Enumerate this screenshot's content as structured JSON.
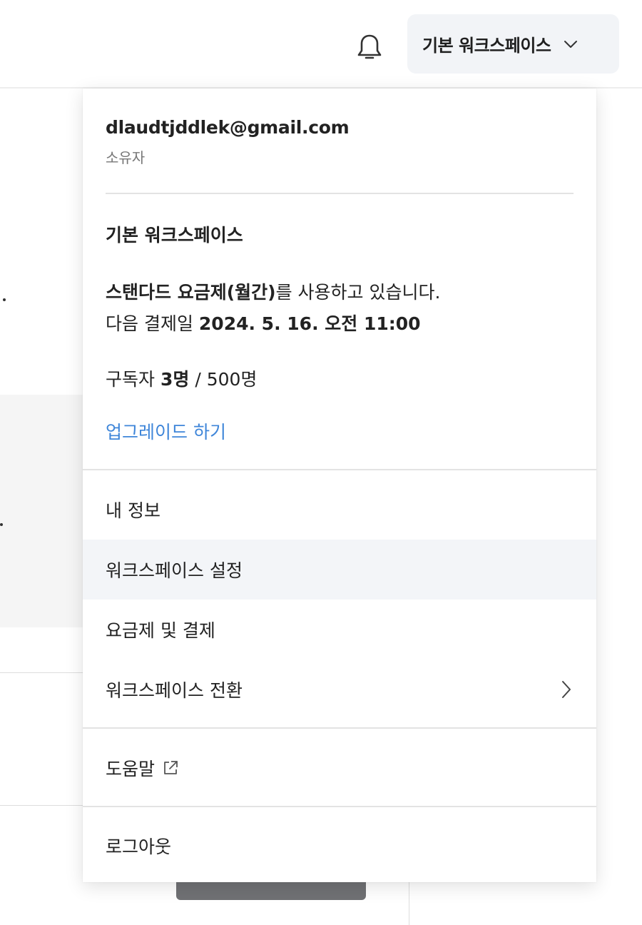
{
  "header": {
    "notification_icon": "bell-icon",
    "workspace_button": {
      "label": "기본 워크스페이스",
      "icon": "chevron-down-icon"
    }
  },
  "background": {
    "panel_color": "#f5f5f5",
    "button_color": "#707174"
  },
  "menu": {
    "account": {
      "email": "dlaudtjddlek@gmail.com",
      "role": "소유자"
    },
    "workspace": {
      "name": "기본 워크스페이스",
      "plan_name": "스탠다드 요금제(월간)",
      "plan_suffix": "를 사용하고 있습니다.",
      "next_payment_label": "다음 결제일",
      "next_payment_date": "2024. 5. 16. 오전 11:00",
      "subscribers_label": "구독자",
      "subscribers_count": "3명",
      "subscribers_separator": " / ",
      "subscribers_limit": "500명",
      "upgrade_link": "업그레이드 하기"
    },
    "items": [
      {
        "label": "내 정보"
      },
      {
        "label": "워크스페이스 설정",
        "highlighted": true
      },
      {
        "label": "요금제 및 결제"
      },
      {
        "label": "워크스페이스 전환",
        "icon": "chevron-right-icon"
      },
      {
        "label": "도움말",
        "icon": "external-link-icon"
      },
      {
        "label": "로그아웃"
      }
    ]
  },
  "colors": {
    "link": "#3f86d9",
    "hover_bg": "#f3f5f8",
    "divider": "#e3e3e3",
    "button_bg": "#f2f4f7"
  }
}
